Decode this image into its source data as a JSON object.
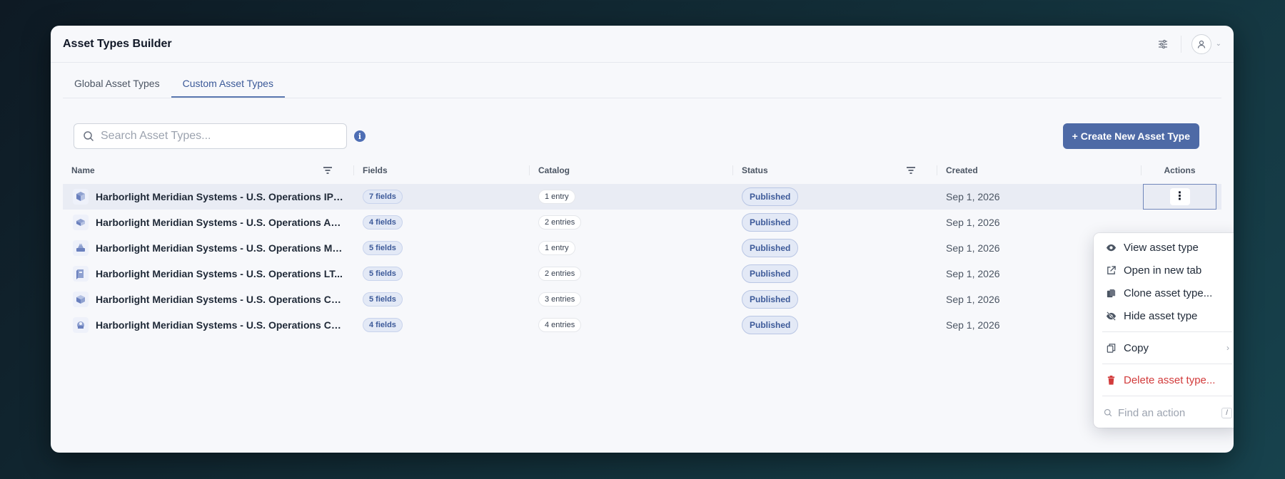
{
  "app": {
    "title": "Asset Types Builder"
  },
  "tabs": [
    {
      "label": "Global Asset Types",
      "active": false
    },
    {
      "label": "Custom Asset Types",
      "active": true
    }
  ],
  "search": {
    "placeholder": "Search Asset Types...",
    "value": ""
  },
  "toolbar": {
    "create_label": "+ Create New Asset Type"
  },
  "table": {
    "columns": [
      "Name",
      "Fields",
      "Catalog",
      "Status",
      "Created",
      "Actions"
    ],
    "rows": [
      {
        "name": "Harborlight Meridian Systems - U.S. Operations IP ...",
        "fields": "7 fields",
        "catalog": "1 entry",
        "status": "Published",
        "created": "Sep 1, 2026"
      },
      {
        "name": "Harborlight Meridian Systems - U.S. Operations Ac...",
        "fields": "4 fields",
        "catalog": "2 entries",
        "status": "Published",
        "created": "Sep 1, 2026"
      },
      {
        "name": "Harborlight Meridian Systems - U.S. Operations Ma...",
        "fields": "5 fields",
        "catalog": "1 entry",
        "status": "Published",
        "created": "Sep 1, 2026"
      },
      {
        "name": "Harborlight Meridian Systems - U.S. Operations LT...",
        "fields": "5 fields",
        "catalog": "2 entries",
        "status": "Published",
        "created": "Sep 1, 2026"
      },
      {
        "name": "Harborlight Meridian Systems - U.S. Operations CP...",
        "fields": "5 fields",
        "catalog": "3 entries",
        "status": "Published",
        "created": "Sep 1, 2026"
      },
      {
        "name": "Harborlight Meridian Systems - U.S. Operations Ca...",
        "fields": "4 fields",
        "catalog": "4 entries",
        "status": "Published",
        "created": "Sep 1, 2026"
      }
    ]
  },
  "menu": {
    "view": "View asset type",
    "open_new_tab": "Open in new tab",
    "clone": "Clone asset type...",
    "hide": "Hide asset type",
    "copy": "Copy",
    "delete": "Delete asset type...",
    "find_placeholder": "Find an action",
    "find_shortcut": "/"
  },
  "colors": {
    "accent": "#4e6aa6",
    "danger": "#d23b3b",
    "pill_bg": "#e3e9f6"
  }
}
